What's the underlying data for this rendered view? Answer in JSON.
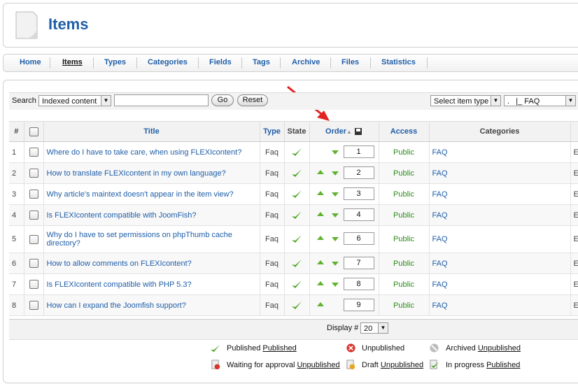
{
  "header": {
    "title": "Items"
  },
  "menu": {
    "items": [
      "Home",
      "Items",
      "Types",
      "Categories",
      "Fields",
      "Tags",
      "Archive",
      "Files",
      "Statistics"
    ],
    "active": "Items"
  },
  "filters": {
    "search_label": "Search",
    "search_scope": "Indexed content",
    "search_value": "",
    "go_label": "Go",
    "reset_label": "Reset",
    "item_type": "Select item type",
    "category": ".   |_ FAQ"
  },
  "table": {
    "headers": {
      "num": "#",
      "title": "Title",
      "type": "Type",
      "state": "State",
      "order": "Order",
      "access": "Access",
      "categories": "Categories"
    },
    "rows": [
      {
        "num": "1",
        "title": "Where do I have to take care, when using FLEXIcontent?",
        "type": "Faq",
        "order": "1",
        "access": "Public",
        "category": "FAQ",
        "extra": "E",
        "up": false,
        "down": true
      },
      {
        "num": "2",
        "title": "How to translate FLEXIcontent in my own language?",
        "type": "Faq",
        "order": "2",
        "access": "Public",
        "category": "FAQ",
        "extra": "E",
        "up": true,
        "down": true
      },
      {
        "num": "3",
        "title": "Why article's maintext doesn't appear in the item view?",
        "type": "Faq",
        "order": "3",
        "access": "Public",
        "category": "FAQ",
        "extra": "E",
        "up": true,
        "down": true
      },
      {
        "num": "4",
        "title": "Is FLEXIcontent compatible with JoomFish?",
        "type": "Faq",
        "order": "4",
        "access": "Public",
        "category": "FAQ",
        "extra": "E",
        "up": true,
        "down": true
      },
      {
        "num": "5",
        "title": "Why do I have to set permissions on phpThumb cache directory?",
        "type": "Faq",
        "order": "6",
        "access": "Public",
        "category": "FAQ",
        "extra": "E",
        "up": true,
        "down": true
      },
      {
        "num": "6",
        "title": "How to allow comments on FLEXIcontent?",
        "type": "Faq",
        "order": "7",
        "access": "Public",
        "category": "FAQ",
        "extra": "E",
        "up": true,
        "down": true
      },
      {
        "num": "7",
        "title": "Is FLEXIcontent compatible with PHP 5.3?",
        "type": "Faq",
        "order": "8",
        "access": "Public",
        "category": "FAQ",
        "extra": "E",
        "up": true,
        "down": true
      },
      {
        "num": "8",
        "title": "How can I expand the Joomfish support?",
        "type": "Faq",
        "order": "9",
        "access": "Public",
        "category": "FAQ",
        "extra": "E",
        "up": true,
        "down": false
      }
    ]
  },
  "footer": {
    "display_label": "Display #",
    "display_value": "20"
  },
  "legend": {
    "published": {
      "label": "Published",
      "link": "Published"
    },
    "unpublished": {
      "label": "Unpublished"
    },
    "archived": {
      "label": "Archived",
      "link": "Unpublished"
    },
    "waiting": {
      "label": "Waiting for approval",
      "link": "Unpublished"
    },
    "draft": {
      "label": "Draft",
      "link": "Unpublished"
    },
    "inprogress": {
      "label": "In progress",
      "link": "Published"
    }
  },
  "colors": {
    "link": "#1f5ea8",
    "published_green": "#5fb330",
    "arrow_red": "#e32222"
  }
}
